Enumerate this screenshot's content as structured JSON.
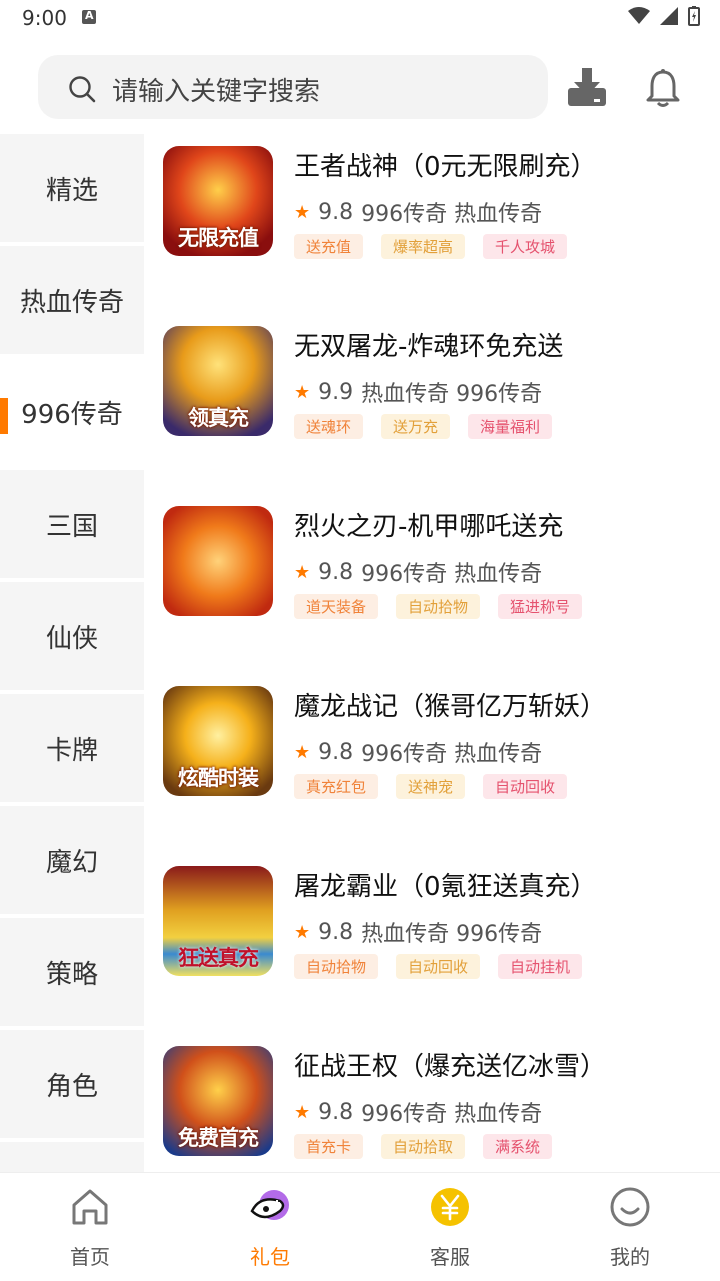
{
  "status_bar": {
    "time": "9:00"
  },
  "search": {
    "placeholder": "请输入关键字搜索"
  },
  "sidebar": {
    "items": [
      {
        "label": "精选"
      },
      {
        "label": "热血传奇"
      },
      {
        "label": "996传奇"
      },
      {
        "label": "三国"
      },
      {
        "label": "仙侠"
      },
      {
        "label": "卡牌"
      },
      {
        "label": "魔幻"
      },
      {
        "label": "策略"
      },
      {
        "label": "角色"
      }
    ],
    "active_index": 2
  },
  "games": [
    {
      "title": "王者战神（0元无限刷充）",
      "rating": "9.8",
      "categories": "996传奇 热血传奇",
      "tags": [
        "送充值",
        "爆率超高",
        "千人攻城"
      ],
      "icon_caption": "无限充值"
    },
    {
      "title": "无双屠龙-炸魂环免充送",
      "rating": "9.9",
      "categories": "热血传奇 996传奇",
      "tags": [
        "送魂环",
        "送万充",
        "海量福利"
      ],
      "icon_caption": "领真充"
    },
    {
      "title": "烈火之刃-机甲哪吒送充",
      "rating": "9.8",
      "categories": "996传奇 热血传奇",
      "tags": [
        "道天装备",
        "自动拾物",
        "猛进称号"
      ],
      "icon_caption": ""
    },
    {
      "title": "魔龙战记（猴哥亿万斩妖）",
      "rating": "9.8",
      "categories": "996传奇 热血传奇",
      "tags": [
        "真充红包",
        "送神宠",
        "自动回收"
      ],
      "icon_caption": "炫酷时装"
    },
    {
      "title": "屠龙霸业（0氪狂送真充）",
      "rating": "9.8",
      "categories": "热血传奇 996传奇",
      "tags": [
        "自动拾物",
        "自动回收",
        "自动挂机"
      ],
      "icon_caption": "狂送真充"
    },
    {
      "title": "征战王权（爆充送亿冰雪）",
      "rating": "9.8",
      "categories": "996传奇 热血传奇",
      "tags": [
        "首充卡",
        "自动拾取",
        "满系统"
      ],
      "icon_caption": "免费首充"
    }
  ],
  "tabbar": {
    "items": [
      {
        "label": "首页",
        "icon": "home-icon"
      },
      {
        "label": "礼包",
        "icon": "gift-icon"
      },
      {
        "label": "客服",
        "icon": "yen-icon"
      },
      {
        "label": "我的",
        "icon": "profile-icon"
      }
    ],
    "active_index": 1
  },
  "colors": {
    "accent": "#ff7a00",
    "nav_bg": "#f5f5f5",
    "search_bg": "#f3f3f3"
  }
}
